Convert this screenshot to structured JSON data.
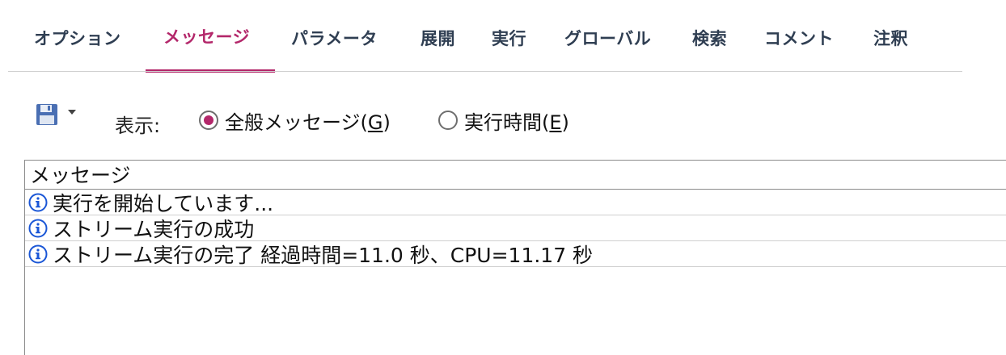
{
  "tabs": [
    {
      "label": "オプション",
      "active": false
    },
    {
      "label": "メッセージ",
      "active": true
    },
    {
      "label": "パラメータ",
      "active": false
    },
    {
      "label": "展開",
      "active": false
    },
    {
      "label": "実行",
      "active": false
    },
    {
      "label": "グローバル",
      "active": false
    },
    {
      "label": "検索",
      "active": false
    },
    {
      "label": "コメント",
      "active": false
    },
    {
      "label": "注釈",
      "active": false
    }
  ],
  "toolbar": {
    "save_icon": "save-icon",
    "dropdown_icon": "chevron-down-icon",
    "show_label": "表示:",
    "radio_general_prefix": "全般メッセージ(",
    "radio_general_key": "G",
    "radio_general_suffix": ")",
    "radio_general_selected": true,
    "radio_exec_prefix": "実行時間(",
    "radio_exec_key": "E",
    "radio_exec_suffix": ")",
    "radio_exec_selected": false
  },
  "messages": {
    "header": "メッセージ",
    "rows": [
      {
        "icon": "info-icon",
        "text": "実行を開始しています..."
      },
      {
        "icon": "info-icon",
        "text": "ストリーム実行の成功"
      },
      {
        "icon": "info-icon",
        "text": "ストリーム実行の完了 経過時間=11.0 秒、CPU=11.17 秒"
      }
    ]
  },
  "colors": {
    "accent": "#b3276a",
    "tab_text": "#2f3e52",
    "info_blue": "#1a56d6"
  }
}
